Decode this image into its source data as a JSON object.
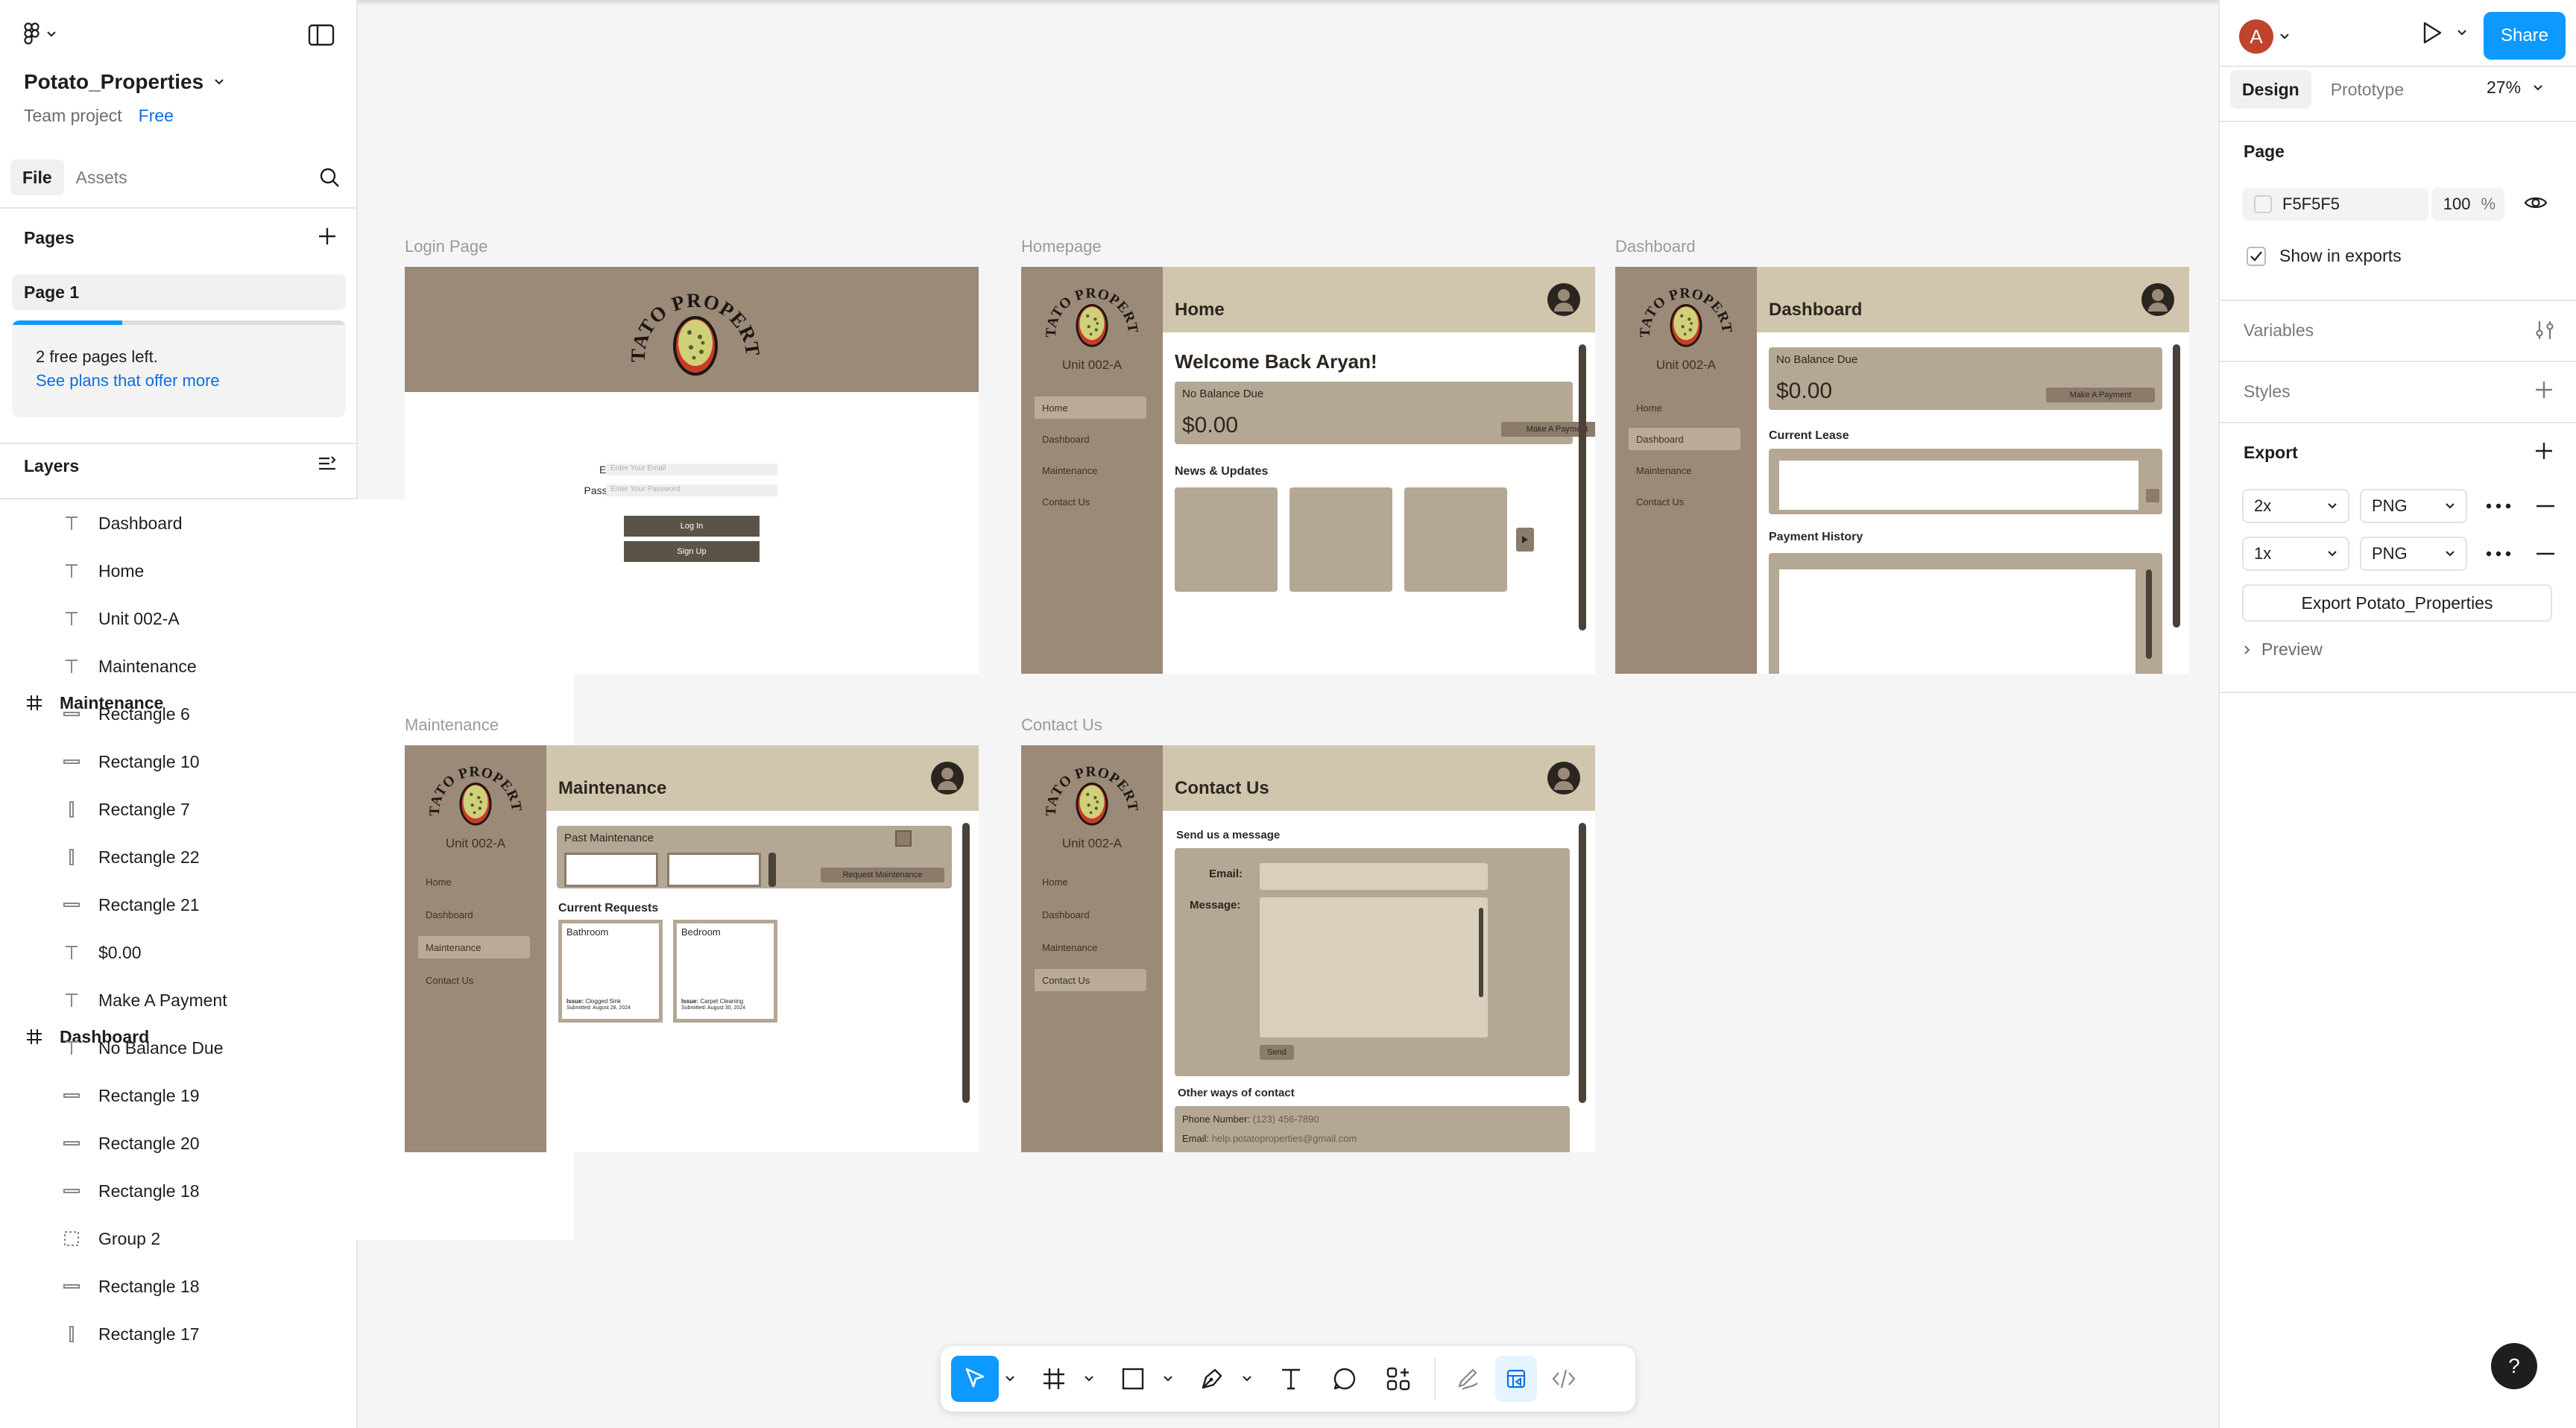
{
  "file": {
    "name": "Potato_Properties",
    "project": "Team project",
    "plan": "Free"
  },
  "left_tabs": [
    "File",
    "Assets"
  ],
  "pages": {
    "heading": "Pages",
    "items": [
      "Page 1"
    ],
    "free_notice": "2 free pages left.",
    "free_link": "See plans that offer more",
    "used_fraction": 0.33
  },
  "layers": {
    "heading": "Layers",
    "items": [
      {
        "kind": "frame",
        "name": "Maintenance"
      },
      {
        "kind": "text",
        "name": "Dashboard"
      },
      {
        "kind": "text",
        "name": "Home"
      },
      {
        "kind": "text",
        "name": "Unit 002-A"
      },
      {
        "kind": "text",
        "name": "Maintenance"
      },
      {
        "kind": "rect-h",
        "name": "Rectangle 6"
      },
      {
        "kind": "rect-h",
        "name": "Rectangle 10"
      },
      {
        "kind": "rect-v",
        "name": "Rectangle 7"
      },
      {
        "kind": "frame",
        "name": "Dashboard"
      },
      {
        "kind": "rect-v",
        "name": "Rectangle 22"
      },
      {
        "kind": "rect-h",
        "name": "Rectangle 21"
      },
      {
        "kind": "text",
        "name": "$0.00"
      },
      {
        "kind": "text",
        "name": "Make A Payment"
      },
      {
        "kind": "text",
        "name": "No Balance Due"
      },
      {
        "kind": "rect-h",
        "name": "Rectangle 19"
      },
      {
        "kind": "rect-h",
        "name": "Rectangle 20"
      },
      {
        "kind": "rect-h",
        "name": "Rectangle 18"
      },
      {
        "kind": "group",
        "name": "Group 2"
      },
      {
        "kind": "rect-h",
        "name": "Rectangle 18"
      },
      {
        "kind": "rect-v",
        "name": "Rectangle 17"
      }
    ]
  },
  "right": {
    "avatar_letter": "A",
    "share_label": "Share",
    "tabs": [
      "Design",
      "Prototype"
    ],
    "zoom": "27%",
    "page_heading": "Page",
    "page_color": "F5F5F5",
    "page_opacity": "100",
    "opacity_unit": "%",
    "show_in_exports": "Show in exports",
    "variables": "Variables",
    "styles": "Styles",
    "export_heading": "Export",
    "exports": [
      {
        "scale": "2x",
        "format": "PNG"
      },
      {
        "scale": "1x",
        "format": "PNG"
      }
    ],
    "export_button": "Export Potato_Properties",
    "preview": "Preview"
  },
  "canvas": {
    "brand_text": "POTATO PROPERTIES",
    "frames": {
      "login": {
        "label": "Login Page",
        "email_label": "Email",
        "email_placeholder": "Enter Your Email",
        "password_label": "Password",
        "password_placeholder": "Enter Your Password",
        "login_btn": "Log In",
        "signup_btn": "Sign Up"
      },
      "homepage": {
        "label": "Homepage",
        "unit": "Unit 002-A",
        "nav": [
          "Home",
          "Dashboard",
          "Maintenance",
          "Contact Us"
        ],
        "title": "Home",
        "welcome": "Welcome Back Aryan!",
        "balance_label": "No Balance Due",
        "balance": "$0.00",
        "pay_btn": "Make A Payment",
        "news": "News & Updates"
      },
      "dashboard": {
        "label": "Dashboard",
        "unit": "Unit 002-A",
        "nav": [
          "Home",
          "Dashboard",
          "Maintenance",
          "Contact Us"
        ],
        "title": "Dashboard",
        "balance_label": "No Balance Due",
        "balance": "$0.00",
        "pay_btn": "Make A Payment",
        "lease": "Current Lease",
        "history": "Payment History"
      },
      "maintenance": {
        "label": "Maintenance",
        "unit": "Unit 002-A",
        "nav": [
          "Home",
          "Dashboard",
          "Maintenance",
          "Contact Us"
        ],
        "title": "Maintenance",
        "past": "Past Maintenance",
        "request_btn": "Request Maintenance",
        "current": "Current Requests",
        "requests": [
          {
            "room": "Bathroom",
            "issue_label": "Issue:",
            "issue": "Clogged Sink",
            "submitted": "Submitted: August 28, 2024"
          },
          {
            "room": "Bedroom",
            "issue_label": "Issue:",
            "issue": "Carpet Cleaning",
            "submitted": "Submitted: August 30, 2024"
          }
        ]
      },
      "contact": {
        "label": "Contact Us",
        "unit": "Unit 002-A",
        "nav": [
          "Home",
          "Dashboard",
          "Maintenance",
          "Contact Us"
        ],
        "title": "Contact Us",
        "send": "Send us a message",
        "email_label": "Email:",
        "message_label": "Message:",
        "send_btn": "Send",
        "other": "Other ways of contact",
        "phone_label": "Phone Number:",
        "phone": "(123) 456-7890",
        "email2_label": "Email:",
        "email2": "help.potatoproperties@gmail.com"
      }
    }
  },
  "toolbar": {
    "tools": [
      "move-tool",
      "frame-tool",
      "shape-tool",
      "pen-tool",
      "text-tool",
      "comment-tool",
      "actions-tool",
      "draw-mode",
      "design-mode",
      "dev-mode"
    ]
  },
  "help": "?",
  "colors": {
    "accent": "#0d99ff",
    "frame_brown": "#9b8a78",
    "frame_beige": "#d0c6ad",
    "avatar": "#c0432b"
  }
}
